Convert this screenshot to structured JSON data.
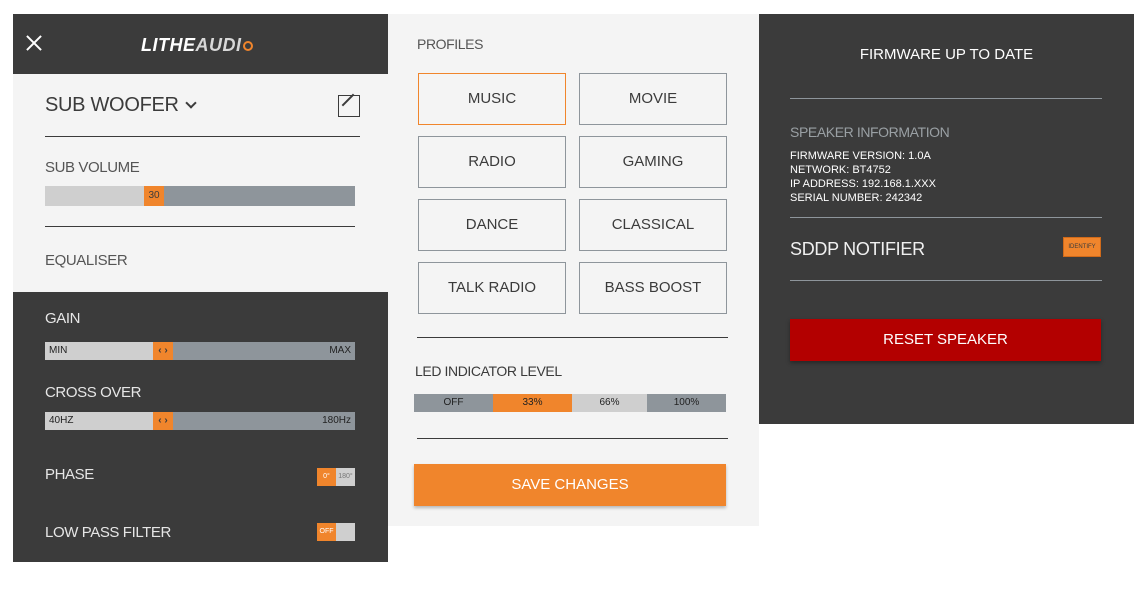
{
  "colors": {
    "accent": "#f0852c",
    "dark": "#3b3b3b",
    "panel": "#f4f4f4",
    "danger": "#b30000",
    "track": "#8e959b"
  },
  "left": {
    "logo_part1": "LITHE",
    "logo_part2": "AUDI",
    "speaker_name": "SUB WOOFER",
    "sub_volume_label": "SUB VOLUME",
    "sub_volume_value": "30",
    "sub_volume_fraction": 0.35,
    "equaliser_label": "EQUALISER",
    "gain_label": "GAIN",
    "gain_min": "MIN",
    "gain_max": "MAX",
    "gain_fraction": 0.38,
    "thumb_glyph": "‹ ›",
    "crossover_label": "CROSS OVER",
    "crossover_min": "40HZ",
    "crossover_max": "180Hz",
    "crossover_fraction": 0.38,
    "phase_label": "PHASE",
    "phase_on": "0°",
    "phase_off": "180°",
    "lowpass_label": "LOW PASS FILTER",
    "lowpass_on": "OFF"
  },
  "middle": {
    "profiles_label": "PROFILES",
    "profiles": [
      "MUSIC",
      "MOVIE",
      "RADIO",
      "GAMING",
      "DANCE",
      "CLASSICAL",
      "TALK RADIO",
      "BASS BOOST"
    ],
    "active_profile": "MUSIC",
    "led_label": "LED INDICATOR LEVEL",
    "led_levels": [
      "OFF",
      "33%",
      "66%",
      "100%"
    ],
    "led_selected": "33%",
    "save_label": "SAVE CHANGES"
  },
  "right": {
    "firmware_status": "FIRMWARE UP TO DATE",
    "speaker_info_label": "SPEAKER INFORMATION",
    "firmware_version": "FIRMWARE VERSION: 1.0A",
    "network": "NETWORK: BT4752",
    "ip_address": "IP ADDRESS: 192.168.1.XXX",
    "serial_number": "SERIAL NUMBER: 242342",
    "sddp_label": "SDDP NOTIFIER",
    "identify_label": "IDENTIFY",
    "reset_label": "RESET SPEAKER"
  }
}
